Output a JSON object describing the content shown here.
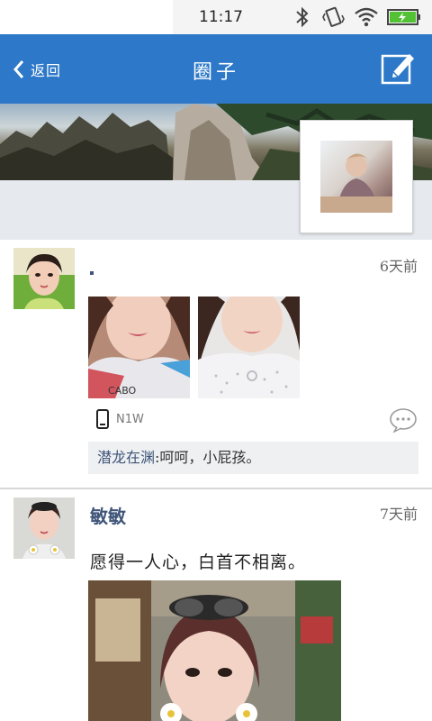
{
  "status_bar": {
    "time": "11:17"
  },
  "header": {
    "back_label": "返回",
    "title": "圈子"
  },
  "posts": [
    {
      "time": "6天前",
      "device": "N1W",
      "comment": {
        "author": "潜龙在渊",
        "text": "呵呵，小屁孩。"
      }
    },
    {
      "username": "敏敏",
      "time": "7天前",
      "text": "愿得一人心，白首不相离。"
    }
  ],
  "colors": {
    "header_bg": "#2d78c8",
    "username": "#3f5579",
    "comment_bg": "#eef0f2"
  }
}
